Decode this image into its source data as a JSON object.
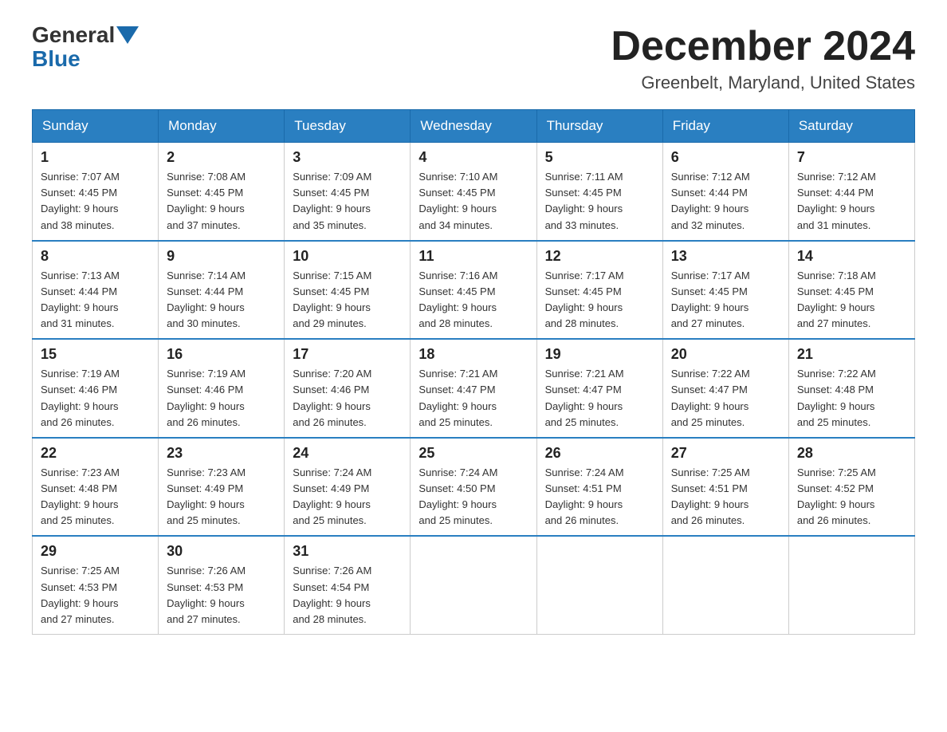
{
  "header": {
    "logo_general": "General",
    "logo_blue": "Blue",
    "month_title": "December 2024",
    "location": "Greenbelt, Maryland, United States"
  },
  "days_of_week": [
    "Sunday",
    "Monday",
    "Tuesday",
    "Wednesday",
    "Thursday",
    "Friday",
    "Saturday"
  ],
  "weeks": [
    [
      {
        "day": "1",
        "sunrise": "7:07 AM",
        "sunset": "4:45 PM",
        "daylight": "9 hours and 38 minutes."
      },
      {
        "day": "2",
        "sunrise": "7:08 AM",
        "sunset": "4:45 PM",
        "daylight": "9 hours and 37 minutes."
      },
      {
        "day": "3",
        "sunrise": "7:09 AM",
        "sunset": "4:45 PM",
        "daylight": "9 hours and 35 minutes."
      },
      {
        "day": "4",
        "sunrise": "7:10 AM",
        "sunset": "4:45 PM",
        "daylight": "9 hours and 34 minutes."
      },
      {
        "day": "5",
        "sunrise": "7:11 AM",
        "sunset": "4:45 PM",
        "daylight": "9 hours and 33 minutes."
      },
      {
        "day": "6",
        "sunrise": "7:12 AM",
        "sunset": "4:44 PM",
        "daylight": "9 hours and 32 minutes."
      },
      {
        "day": "7",
        "sunrise": "7:12 AM",
        "sunset": "4:44 PM",
        "daylight": "9 hours and 31 minutes."
      }
    ],
    [
      {
        "day": "8",
        "sunrise": "7:13 AM",
        "sunset": "4:44 PM",
        "daylight": "9 hours and 31 minutes."
      },
      {
        "day": "9",
        "sunrise": "7:14 AM",
        "sunset": "4:44 PM",
        "daylight": "9 hours and 30 minutes."
      },
      {
        "day": "10",
        "sunrise": "7:15 AM",
        "sunset": "4:45 PM",
        "daylight": "9 hours and 29 minutes."
      },
      {
        "day": "11",
        "sunrise": "7:16 AM",
        "sunset": "4:45 PM",
        "daylight": "9 hours and 28 minutes."
      },
      {
        "day": "12",
        "sunrise": "7:17 AM",
        "sunset": "4:45 PM",
        "daylight": "9 hours and 28 minutes."
      },
      {
        "day": "13",
        "sunrise": "7:17 AM",
        "sunset": "4:45 PM",
        "daylight": "9 hours and 27 minutes."
      },
      {
        "day": "14",
        "sunrise": "7:18 AM",
        "sunset": "4:45 PM",
        "daylight": "9 hours and 27 minutes."
      }
    ],
    [
      {
        "day": "15",
        "sunrise": "7:19 AM",
        "sunset": "4:46 PM",
        "daylight": "9 hours and 26 minutes."
      },
      {
        "day": "16",
        "sunrise": "7:19 AM",
        "sunset": "4:46 PM",
        "daylight": "9 hours and 26 minutes."
      },
      {
        "day": "17",
        "sunrise": "7:20 AM",
        "sunset": "4:46 PM",
        "daylight": "9 hours and 26 minutes."
      },
      {
        "day": "18",
        "sunrise": "7:21 AM",
        "sunset": "4:47 PM",
        "daylight": "9 hours and 25 minutes."
      },
      {
        "day": "19",
        "sunrise": "7:21 AM",
        "sunset": "4:47 PM",
        "daylight": "9 hours and 25 minutes."
      },
      {
        "day": "20",
        "sunrise": "7:22 AM",
        "sunset": "4:47 PM",
        "daylight": "9 hours and 25 minutes."
      },
      {
        "day": "21",
        "sunrise": "7:22 AM",
        "sunset": "4:48 PM",
        "daylight": "9 hours and 25 minutes."
      }
    ],
    [
      {
        "day": "22",
        "sunrise": "7:23 AM",
        "sunset": "4:48 PM",
        "daylight": "9 hours and 25 minutes."
      },
      {
        "day": "23",
        "sunrise": "7:23 AM",
        "sunset": "4:49 PM",
        "daylight": "9 hours and 25 minutes."
      },
      {
        "day": "24",
        "sunrise": "7:24 AM",
        "sunset": "4:49 PM",
        "daylight": "9 hours and 25 minutes."
      },
      {
        "day": "25",
        "sunrise": "7:24 AM",
        "sunset": "4:50 PM",
        "daylight": "9 hours and 25 minutes."
      },
      {
        "day": "26",
        "sunrise": "7:24 AM",
        "sunset": "4:51 PM",
        "daylight": "9 hours and 26 minutes."
      },
      {
        "day": "27",
        "sunrise": "7:25 AM",
        "sunset": "4:51 PM",
        "daylight": "9 hours and 26 minutes."
      },
      {
        "day": "28",
        "sunrise": "7:25 AM",
        "sunset": "4:52 PM",
        "daylight": "9 hours and 26 minutes."
      }
    ],
    [
      {
        "day": "29",
        "sunrise": "7:25 AM",
        "sunset": "4:53 PM",
        "daylight": "9 hours and 27 minutes."
      },
      {
        "day": "30",
        "sunrise": "7:26 AM",
        "sunset": "4:53 PM",
        "daylight": "9 hours and 27 minutes."
      },
      {
        "day": "31",
        "sunrise": "7:26 AM",
        "sunset": "4:54 PM",
        "daylight": "9 hours and 28 minutes."
      },
      null,
      null,
      null,
      null
    ]
  ],
  "labels": {
    "sunrise_prefix": "Sunrise: ",
    "sunset_prefix": "Sunset: ",
    "daylight_prefix": "Daylight: 9 hours"
  }
}
